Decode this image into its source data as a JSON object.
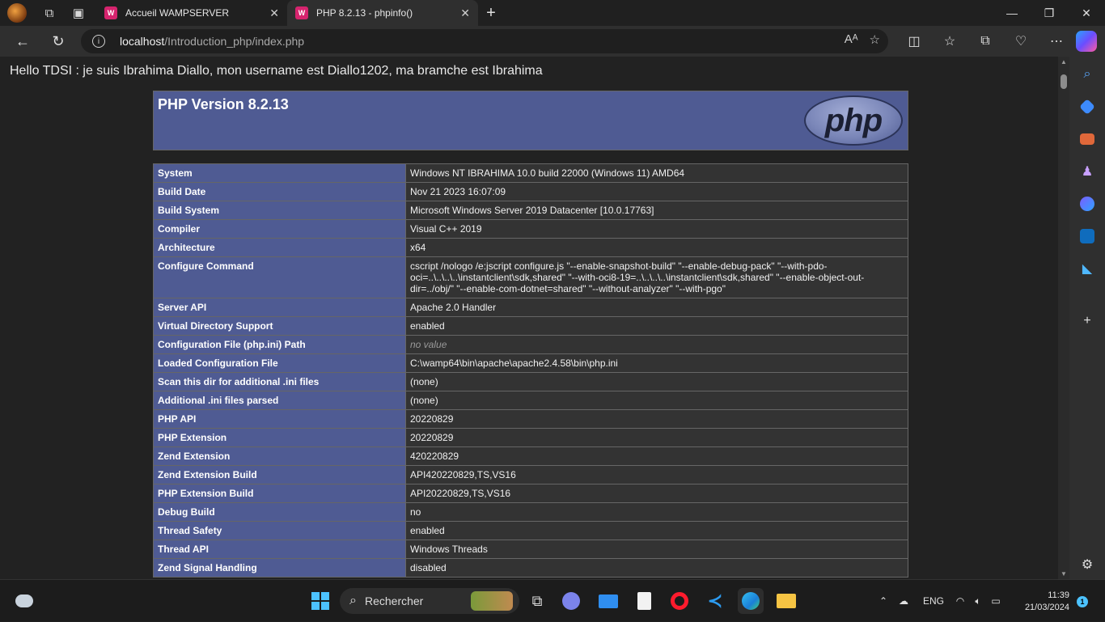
{
  "tabs": [
    {
      "title": "Accueil WAMPSERVER",
      "favicon": "W",
      "active": false
    },
    {
      "title": "PHP 8.2.13 - phpinfo()",
      "favicon": "W",
      "active": true
    }
  ],
  "address": {
    "host": "localhost",
    "path": "/Introduction_php/index.php"
  },
  "page": {
    "hello": "Hello TDSI : je suis Ibrahima Diallo, mon username est Diallo1202, ma bramche est Ibrahima",
    "php_version": "PHP Version 8.2.13",
    "logo_text": "php",
    "rows": [
      {
        "k": "System",
        "v": "Windows NT IBRAHIMA 10.0 build 22000 (Windows 11) AMD64"
      },
      {
        "k": "Build Date",
        "v": "Nov 21 2023 16:07:09"
      },
      {
        "k": "Build System",
        "v": "Microsoft Windows Server 2019 Datacenter [10.0.17763]"
      },
      {
        "k": "Compiler",
        "v": "Visual C++ 2019"
      },
      {
        "k": "Architecture",
        "v": "x64"
      },
      {
        "k": "Configure Command",
        "v": "cscript /nologo /e:jscript configure.js \"--enable-snapshot-build\" \"--enable-debug-pack\" \"--with-pdo-oci=..\\..\\..\\..\\instantclient\\sdk,shared\" \"--with-oci8-19=..\\..\\..\\..\\instantclient\\sdk,shared\" \"--enable-object-out-dir=../obj/\" \"--enable-com-dotnet=shared\" \"--without-analyzer\" \"--with-pgo\""
      },
      {
        "k": "Server API",
        "v": "Apache 2.0 Handler"
      },
      {
        "k": "Virtual Directory Support",
        "v": "enabled"
      },
      {
        "k": "Configuration File (php.ini) Path",
        "v": "no value",
        "novalue": true
      },
      {
        "k": "Loaded Configuration File",
        "v": "C:\\wamp64\\bin\\apache\\apache2.4.58\\bin\\php.ini"
      },
      {
        "k": "Scan this dir for additional .ini files",
        "v": "(none)"
      },
      {
        "k": "Additional .ini files parsed",
        "v": "(none)"
      },
      {
        "k": "PHP API",
        "v": "20220829"
      },
      {
        "k": "PHP Extension",
        "v": "20220829"
      },
      {
        "k": "Zend Extension",
        "v": "420220829"
      },
      {
        "k": "Zend Extension Build",
        "v": "API420220829,TS,VS16"
      },
      {
        "k": "PHP Extension Build",
        "v": "API20220829,TS,VS16"
      },
      {
        "k": "Debug Build",
        "v": "no"
      },
      {
        "k": "Thread Safety",
        "v": "enabled"
      },
      {
        "k": "Thread API",
        "v": "Windows Threads"
      },
      {
        "k": "Zend Signal Handling",
        "v": "disabled"
      }
    ]
  },
  "taskbar": {
    "search_placeholder": "Rechercher",
    "language": "ENG",
    "time": "11:39",
    "date": "21/03/2024",
    "notifications": "1"
  },
  "colors": {
    "php_header": "#4f5b93",
    "value_cell": "#333333",
    "accent": "#4cc2ff"
  }
}
